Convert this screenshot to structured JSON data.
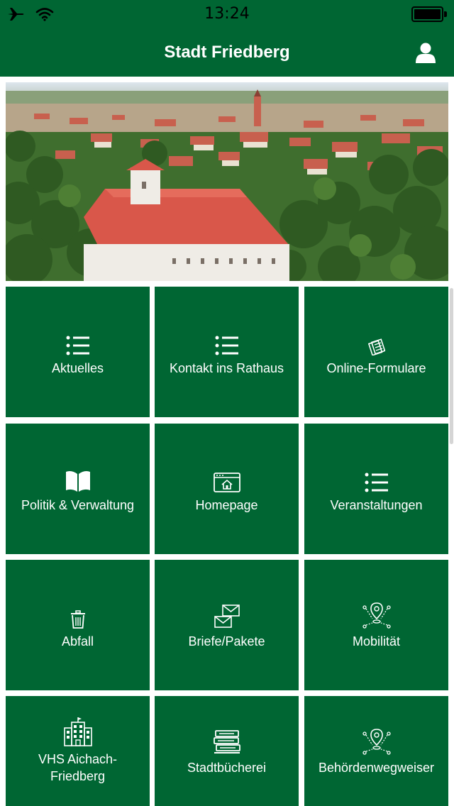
{
  "status_bar": {
    "time": "13:24"
  },
  "nav": {
    "title": "Stadt Friedberg"
  },
  "tiles": [
    {
      "label": "Aktuelles",
      "icon": "list-icon"
    },
    {
      "label": "Kontakt ins Rathaus",
      "icon": "list-icon"
    },
    {
      "label": "Online-Formulare",
      "icon": "form-icon"
    },
    {
      "label": "Politik & Verwaltung",
      "icon": "book-icon"
    },
    {
      "label": "Homepage",
      "icon": "browser-home-icon"
    },
    {
      "label": "Veranstaltungen",
      "icon": "list-icon"
    },
    {
      "label": "Abfall",
      "icon": "trash-icon"
    },
    {
      "label": "Briefe/Pakete",
      "icon": "envelopes-icon"
    },
    {
      "label": "Mobilität",
      "icon": "location-route-icon"
    },
    {
      "label": "VHS Aichach-Friedberg",
      "icon": "building-icon"
    },
    {
      "label": "Stadtbücherei",
      "icon": "books-icon"
    },
    {
      "label": "Behördenwegweiser",
      "icon": "location-route-icon"
    }
  ],
  "colors": {
    "primary": "#006633",
    "tile_text": "#ffffff",
    "roof": "#d9574a"
  }
}
